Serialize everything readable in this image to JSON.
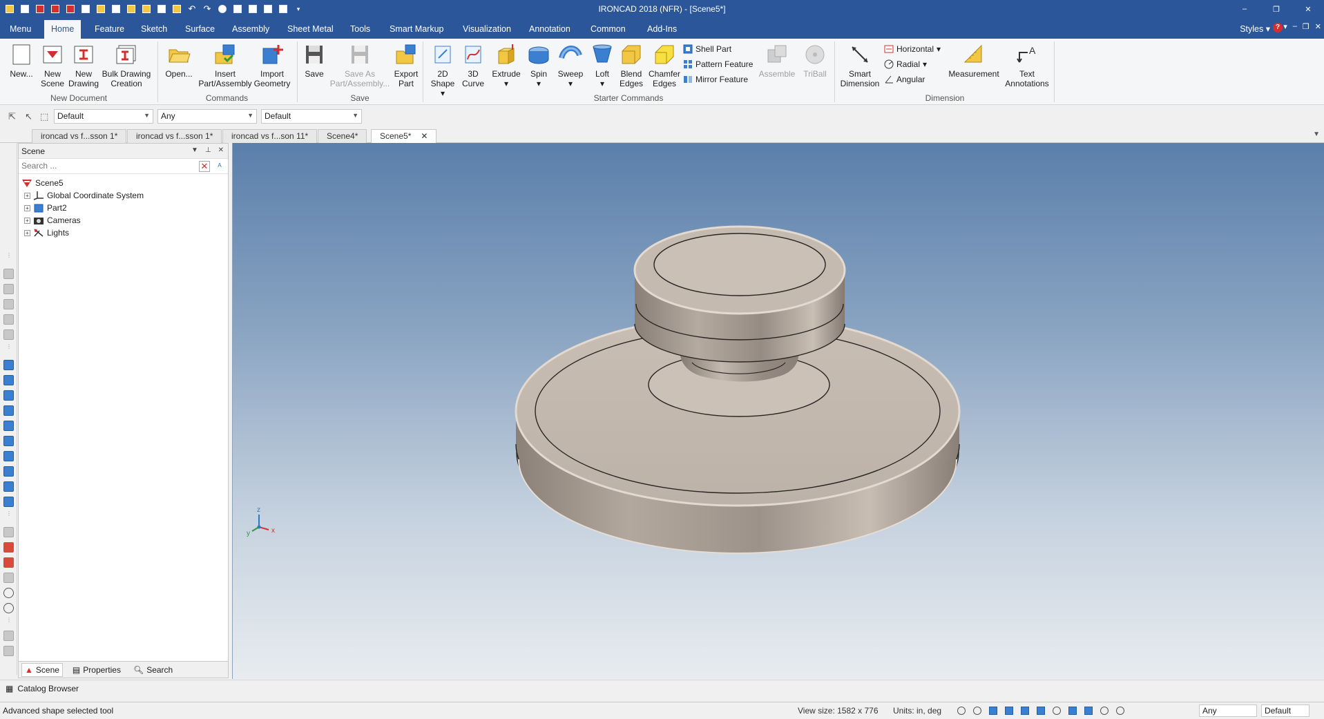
{
  "window": {
    "title": "IRONCAD 2018 (NFR) - [Scene5*]",
    "controls": [
      "–",
      "❐",
      "✕"
    ]
  },
  "ribbon_tabs": [
    "Menu",
    "Home",
    "Feature",
    "Sketch",
    "Surface",
    "Assembly",
    "Sheet Metal",
    "Tools",
    "Smart Markup",
    "Visualization",
    "Annotation",
    "Common",
    "Add-Ins"
  ],
  "ribbon_right": {
    "styles": "Styles",
    "help": "?"
  },
  "groups": {
    "new_document": {
      "label": "New Document",
      "new": "New...",
      "new_scene": [
        "New",
        "Scene"
      ],
      "new_drawing": [
        "New",
        "Drawing"
      ],
      "bulk_drawing": [
        "Bulk Drawing",
        "Creation"
      ]
    },
    "commands": {
      "label": "Commands",
      "open": "Open...",
      "insert": [
        "Insert",
        "Part/Assembly"
      ],
      "import": [
        "Import",
        "Geometry"
      ]
    },
    "save": {
      "label": "Save",
      "save": "Save",
      "save_as": [
        "Save As",
        "Part/Assembly..."
      ]
    },
    "starter": {
      "label": "Starter Commands",
      "export": [
        "Export",
        "Part"
      ],
      "shape2d": [
        "2D",
        "Shape"
      ],
      "curve3d": [
        "3D",
        "Curve"
      ],
      "extrude": "Extrude",
      "spin": "Spin",
      "sweep": "Sweep",
      "loft": "Loft",
      "blend": [
        "Blend",
        "Edges"
      ],
      "chamfer": [
        "Chamfer",
        "Edges"
      ],
      "shell": "Shell Part",
      "pattern": "Pattern Feature",
      "mirror": "Mirror Feature",
      "assemble": "Assemble",
      "triball": "TriBall"
    },
    "dimension": {
      "label": "Dimension",
      "smart": [
        "Smart",
        "Dimension"
      ],
      "horizontal": "Horizontal",
      "radial": "Radial",
      "angular": "Angular",
      "measurement": "Measurement",
      "text_annotations": [
        "Text",
        "Annotations"
      ]
    }
  },
  "selection_bar": {
    "combo1": "Default",
    "combo2": "Any",
    "combo3": "Default"
  },
  "doc_tabs": [
    "ironcad vs f...sson 1*",
    "ironcad vs f...sson 1*",
    "ironcad vs f...son 11*",
    "Scene4*",
    "Scene5*"
  ],
  "scene_panel": {
    "title": "Scene",
    "search_placeholder": "Search ...",
    "tree": {
      "root": "Scene5",
      "children": [
        "Global Coordinate System",
        "Part2",
        "Cameras",
        "Lights"
      ]
    },
    "footer_tabs": [
      "Scene",
      "Properties",
      "Search"
    ]
  },
  "triad": {
    "x": "x",
    "y": "y",
    "z": "z"
  },
  "catalog_bar": {
    "label": "Catalog Browser"
  },
  "status": {
    "message": "Advanced shape selected tool",
    "view_size": "View size: 1582 x 776",
    "units": "Units: in, deg",
    "combo_any": "Any",
    "combo_default": "Default"
  },
  "colors": {
    "title_bar": "#2b579a",
    "accent_blue": "#3a7fd0",
    "viewport_top": "#5a7fab",
    "viewport_bottom": "#e8ecf0",
    "part_metal": "#a89e94"
  },
  "icons": [
    "new-document-icon",
    "new-scene-icon",
    "new-drawing-icon",
    "bulk-drawing-icon",
    "open-folder-icon",
    "insert-part-icon",
    "import-geometry-icon",
    "save-icon",
    "save-as-icon",
    "export-part-icon",
    "shape-2d-icon",
    "curve-3d-icon",
    "extrude-icon",
    "spin-icon",
    "sweep-icon",
    "loft-icon",
    "blend-edges-icon",
    "chamfer-edges-icon",
    "shell-part-icon",
    "pattern-feature-icon",
    "mirror-feature-icon",
    "assemble-icon",
    "triball-icon",
    "smart-dimension-icon",
    "horizontal-dim-icon",
    "radial-dim-icon",
    "angular-dim-icon",
    "measurement-icon",
    "text-annotations-icon"
  ]
}
